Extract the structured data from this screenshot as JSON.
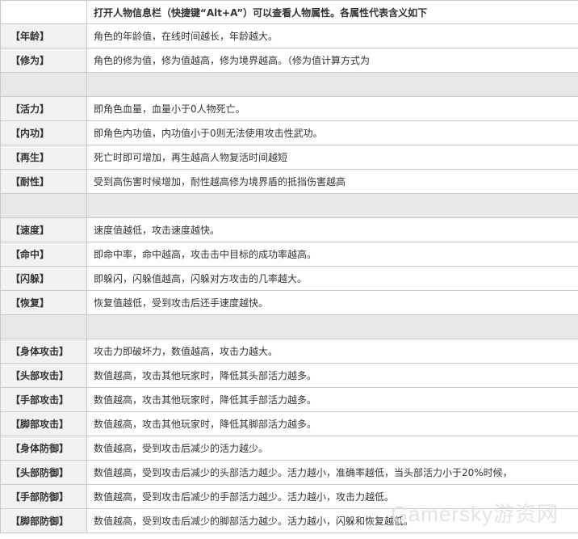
{
  "header": {
    "label": "",
    "text": "打开人物信息栏（快捷键“Alt+A”）可以查看人物属性。各属性代表含义如下"
  },
  "rows": [
    {
      "label": "【年龄】",
      "desc": "角色的年龄值，在线时间越长，年龄越大。"
    },
    {
      "label": "【修为】",
      "desc": "角色的修为值，修为值越高，修为境界越高。（修为值计算方式为"
    },
    {
      "label": "",
      "desc": ""
    },
    {
      "label": "【活力】",
      "desc": "即角色血量，血量小于0人物死亡。"
    },
    {
      "label": "【内功】",
      "desc": "即角色内功值，内功值小于0则无法使用攻击性武功。"
    },
    {
      "label": "【再生】",
      "desc": "死亡时即可增加，再生越高人物复活时间越短"
    },
    {
      "label": "【耐性】",
      "desc": "受到高伤害时候增加，耐性越高修为境界盾的抵挡伤害越高"
    },
    {
      "label": "",
      "desc": ""
    },
    {
      "label": "【速度】",
      "desc": "速度值越低，攻击速度越快。"
    },
    {
      "label": "【命中】",
      "desc": "即命中率，命中越高，攻击击中目标的成功率越高。"
    },
    {
      "label": "【闪躲】",
      "desc": "即躲闪，闪躲值越高，闪躲对方攻击的几率越大。"
    },
    {
      "label": "【恢复】",
      "desc": "恢复值越低，受到攻击后还手速度越快。"
    },
    {
      "label": "",
      "desc": ""
    },
    {
      "label": "【身体攻击】",
      "desc": "攻击力即破坏力，数值越高，攻击力越大。"
    },
    {
      "label": "【头部攻击】",
      "desc": "数值越高，攻击其他玩家时，降低其头部活力越多。"
    },
    {
      "label": "【手部攻击】",
      "desc": "数值越高，攻击其他玩家时，降低其手部活力越多。"
    },
    {
      "label": "【脚部攻击】",
      "desc": "数值越高，攻击其他玩家时，降低其脚部活力越多。"
    },
    {
      "label": "【身体防御】",
      "desc": "数值越高，受到攻击后减少的活力越少。"
    },
    {
      "label": "【头部防御】",
      "desc": "数值越高，受到攻击后减少的头部活力越少。活力越小，准确率越低，当头部活力小于20%时候，"
    },
    {
      "label": "【手部防御】",
      "desc": "数值越高，受到攻击后减少的手部活力越少。活力越小，攻击力越低。"
    },
    {
      "label": "【脚部防御】",
      "desc": "数值越高，受到攻击后减少的脚部活力越少。活力越小，闪躲和恢复越低。"
    }
  ],
  "watermark": "Gamersky游资网"
}
